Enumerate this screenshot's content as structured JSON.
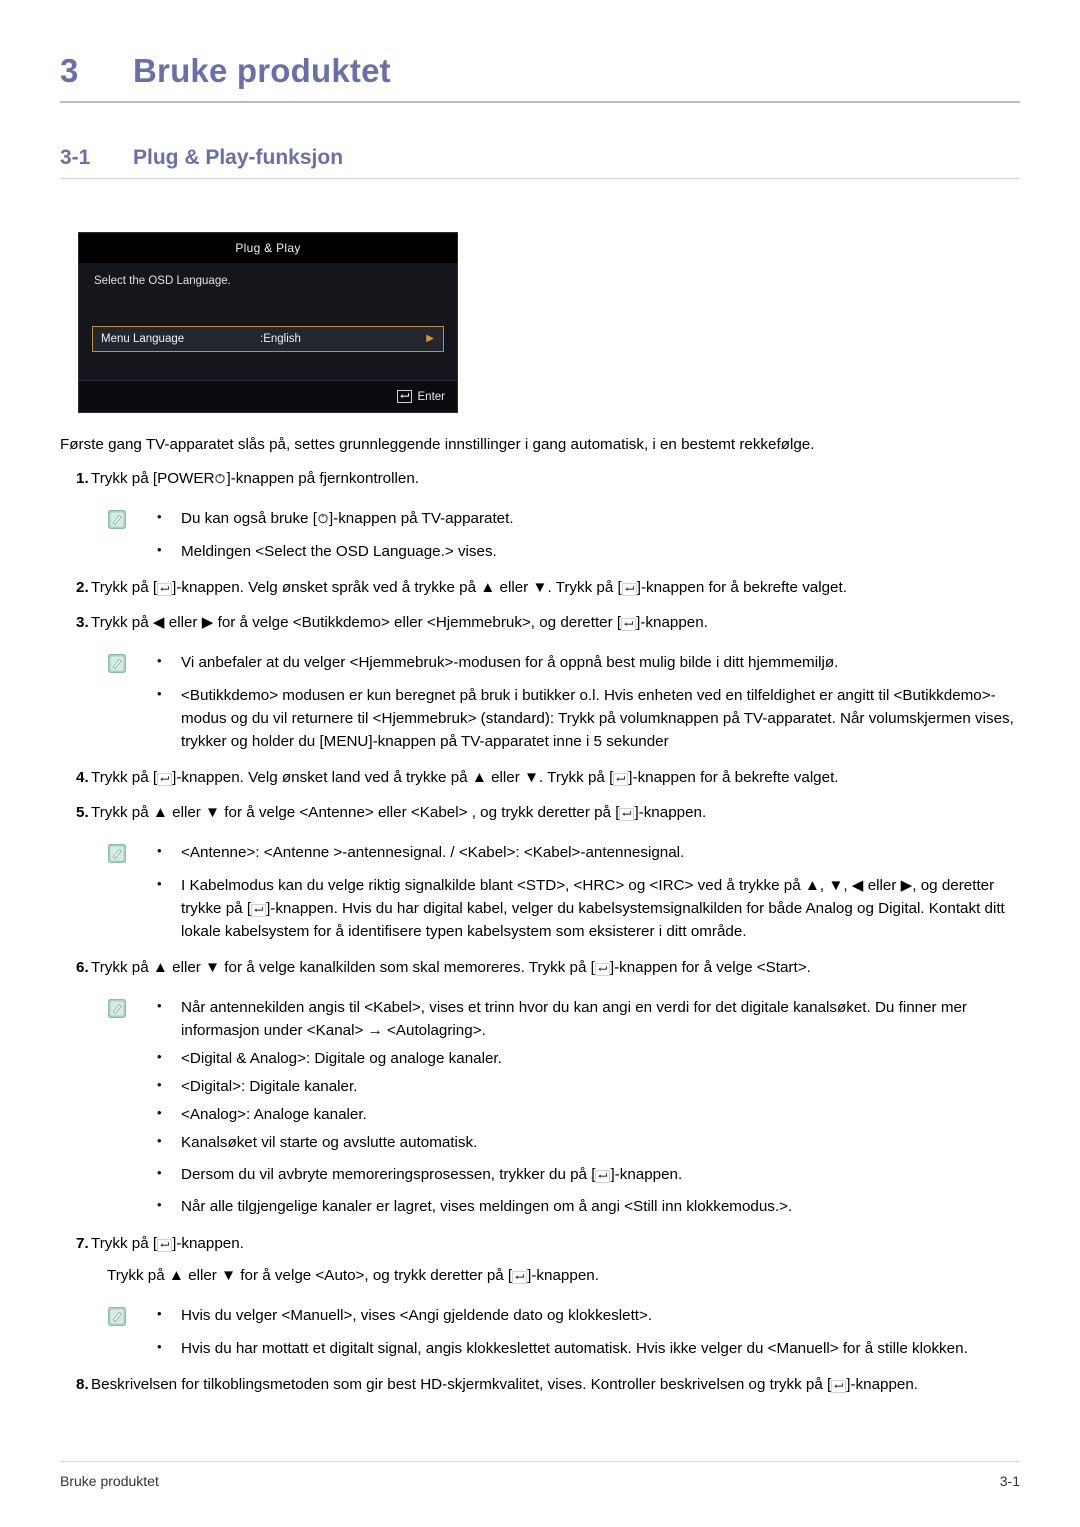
{
  "chapter": {
    "number": "3",
    "title": "Bruke produktet"
  },
  "section": {
    "number": "3-1",
    "title": "Plug & Play-funksjon"
  },
  "osd": {
    "title": "Plug & Play",
    "prompt": "Select the OSD Language.",
    "row_label": "Menu Language",
    "row_value": ":English",
    "enter_label": "Enter",
    "colors": {
      "background": "#14161c",
      "titlebar": "#000000",
      "highlight_border": "#c09038",
      "highlight_fill": "#23262f",
      "arrow": "#d09c2e",
      "footer": "#0b0c10",
      "text": "#e8e9ec"
    }
  },
  "intro": "Første gang TV-apparatet slås på, settes grunnleggende innstillinger i gang automatisk, i en bestemt rekkefølge.",
  "steps": {
    "s1": {
      "num": "1.",
      "a": "Trykk på [POWER",
      "b": "]-knappen på fjernkontrollen."
    },
    "note1": {
      "b1a": "Du kan også bruke [",
      "b1b": "]-knappen på TV-apparatet.",
      "b2": "Meldingen <Select the OSD Language.> vises."
    },
    "s2": {
      "num": "2.",
      "a": "Trykk på [",
      "b": "]-knappen. Velg ønsket språk ved å trykke på ▲ eller ▼. Trykk på [",
      "c": "]-knappen for å bekrefte valget."
    },
    "s3": {
      "num": "3.",
      "a": "Trykk på ◀ eller ▶ for å velge <Butikkdemo> eller <Hjemmebruk>, og deretter [",
      "b": "]-knappen."
    },
    "note2": {
      "b1": "Vi anbefaler at du velger <Hjemmebruk>-modusen for å oppnå best mulig bilde i ditt hjemmemiljø.",
      "b2": "<Butikkdemo> modusen er kun beregnet på bruk i butikker o.l. Hvis enheten ved en tilfeldighet er angitt til <Butikkdemo>-modus og du vil returnere til <Hjemmebruk> (standard): Trykk på volumknappen på TV-apparatet. Når volumskjermen vises, trykker og holder du [MENU]-knappen på TV-apparatet inne i 5 sekunder"
    },
    "s4": {
      "num": "4.",
      "a": "Trykk på [",
      "b": "]-knappen. Velg ønsket land ved å trykke på ▲ eller ▼. Trykk på [",
      "c": "]-knappen for å bekrefte valget."
    },
    "s5": {
      "num": "5.",
      "a": "Trykk på ▲ eller ▼ for å velge <Antenne> eller <Kabel> , og trykk deretter på [",
      "b": "]-knappen."
    },
    "note3": {
      "b1": "<Antenne>: <Antenne >-antennesignal. / <Kabel>: <Kabel>-antennesignal.",
      "b2a": "I Kabelmodus kan du velge riktig signalkilde blant <STD>, <HRC> og <IRC> ved å trykke på ▲, ▼, ◀ eller ▶, og deretter trykke på [",
      "b2b": "]-knappen. Hvis du har digital kabel, velger du kabelsystemsignalkilden for både Analog og Digital. Kontakt ditt lokale kabelsystem for å identifisere typen kabelsystem som eksisterer i ditt område."
    },
    "s6": {
      "num": "6.",
      "a": "Trykk på ▲ eller ▼ for å velge kanalkilden som skal memoreres. Trykk på [",
      "b": "]-knappen for å velge <Start>."
    },
    "note4": {
      "b1": "Når antennekilden angis til <Kabel>, vises et trinn hvor du kan angi en verdi for det digitale kanalsøket. Du finner mer informasjon under <Kanal> → <Autolagring>.",
      "b2": "<Digital & Analog>: Digitale og analoge kanaler.",
      "b3": "<Digital>: Digitale kanaler.",
      "b4": "<Analog>: Analoge kanaler.",
      "b5": "Kanalsøket vil starte og avslutte automatisk.",
      "b6a": "Dersom du vil avbryte memoreringsprosessen, trykker du på [",
      "b6b": "]-knappen.",
      "b7": "Når alle tilgjengelige kanaler er lagret, vises meldingen om å angi <Still inn klokkemodus.>."
    },
    "s7": {
      "num": "7.",
      "a": "Trykk på [",
      "b": "]-knappen.",
      "sub_a": "Trykk på ▲ eller ▼ for å velge <Auto>, og trykk deretter på [",
      "sub_b": "]-knappen."
    },
    "note5": {
      "b1": "Hvis du velger <Manuell>, vises <Angi gjeldende dato og klokkeslett>.",
      "b2": "Hvis du har mottatt et digitalt signal, angis klokkeslettet automatisk. Hvis ikke velger du <Manuell> for å stille klokken."
    },
    "s8": {
      "num": "8.",
      "a": "Beskrivelsen for tilkoblingsmetoden som gir best HD-skjermkvalitet, vises. Kontroller beskrivelsen og trykk på [",
      "b": "]-knappen."
    }
  },
  "footer": {
    "left": "Bruke produktet",
    "right": "3-1"
  },
  "icons": {
    "note": "note-pencil-icon",
    "power": "power-icon",
    "enter": "enter-key-icon",
    "arrow_right": "arrow-right-icon"
  },
  "theme": {
    "heading_color": "#6a6fa8",
    "rule_color": "#b9bad2"
  }
}
